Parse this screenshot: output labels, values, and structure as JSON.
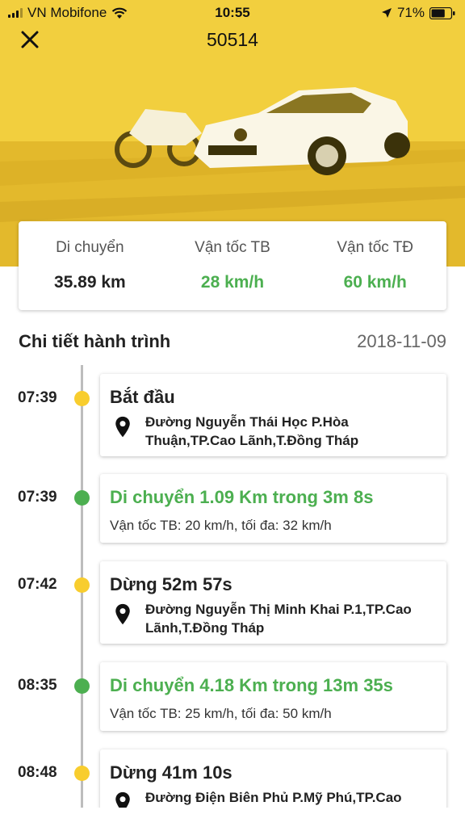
{
  "status_bar": {
    "carrier": "VN Mobifone",
    "time": "10:55",
    "battery": "71%",
    "battery_level": 0.71
  },
  "nav": {
    "title": "50514"
  },
  "summary": {
    "distance_label": "Di chuyển",
    "distance_value": "35.89 km",
    "avg_speed_label": "Vận tốc TB",
    "avg_speed_value": "28 km/h",
    "max_speed_label": "Vận tốc TĐ",
    "max_speed_value": "60 km/h"
  },
  "section": {
    "title": "Chi tiết hành trình",
    "date": "2018-11-09"
  },
  "events": [
    {
      "time": "07:39",
      "type": "start",
      "heading": "Bắt đầu",
      "address": "Đường Nguyễn Thái Học P.Hòa Thuận,TP.Cao Lãnh,T.Đồng Tháp"
    },
    {
      "time": "07:39",
      "type": "move",
      "heading": "Di chuyển 1.09 Km trong 3m 8s",
      "detail": "Vận tốc TB: 20 km/h, tối đa: 32 km/h"
    },
    {
      "time": "07:42",
      "type": "stop",
      "heading": "Dừng 52m 57s",
      "address": "Đường Nguyễn Thị Minh Khai P.1,TP.Cao Lãnh,T.Đồng Tháp"
    },
    {
      "time": "08:35",
      "type": "move",
      "heading": "Di chuyển 4.18 Km trong 13m 35s",
      "detail": "Vận tốc TB: 25 km/h, tối đa: 50 km/h"
    },
    {
      "time": "08:48",
      "type": "stop",
      "heading": "Dừng 41m 10s",
      "address": "Đường Điện Biên Phủ P.Mỹ Phú,TP.Cao Lãnh,T.Đồng Tháp"
    }
  ],
  "colors": {
    "accent_yellow": "#f8cd2e",
    "accent_green": "#4caf50"
  }
}
